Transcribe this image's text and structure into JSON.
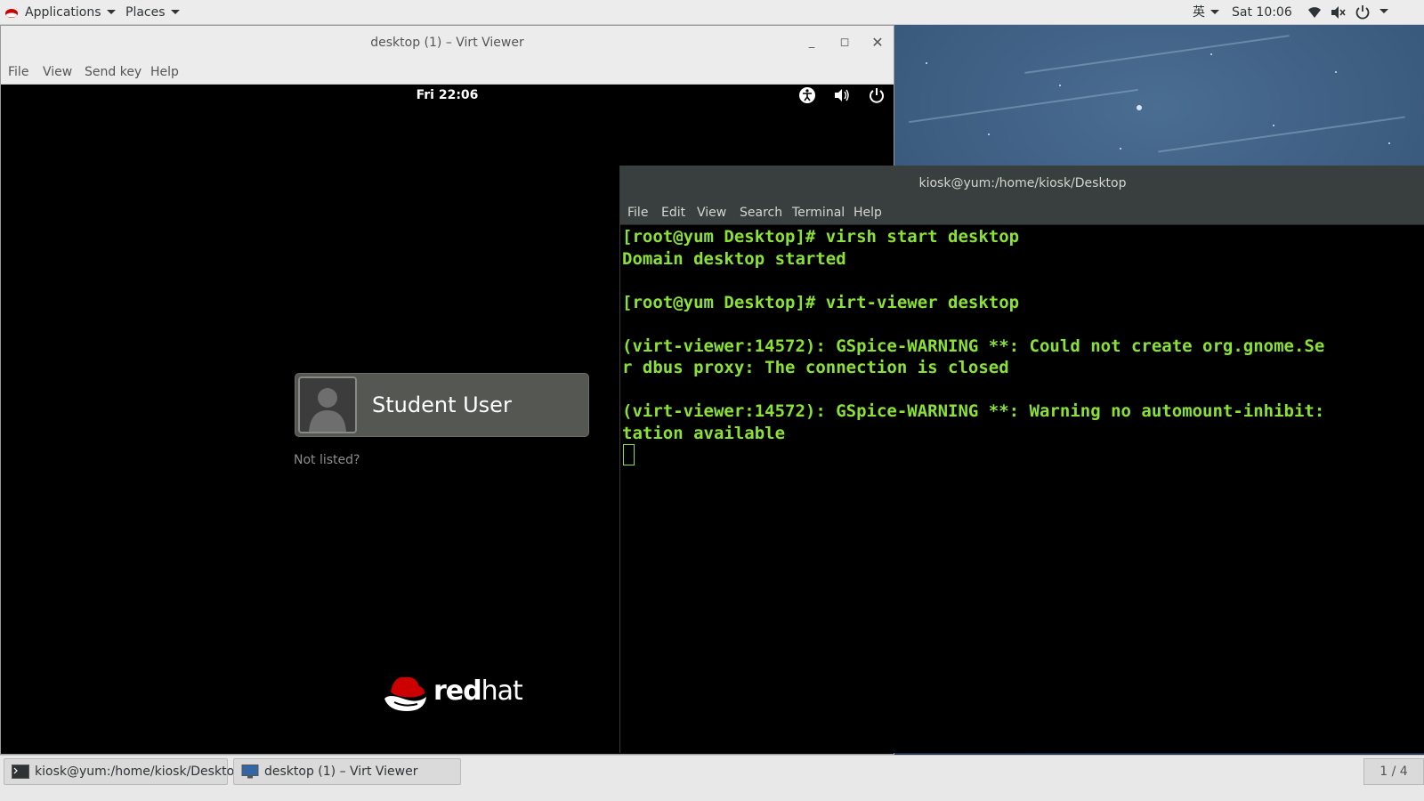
{
  "top_panel": {
    "applications_label": "Applications",
    "places_label": "Places",
    "input_method": "英",
    "clock": "Sat 10:06"
  },
  "virt_viewer": {
    "title": "desktop (1) – Virt Viewer",
    "menu": [
      "File",
      "View",
      "Send key",
      "Help"
    ],
    "vm": {
      "clock": "Fri 22:06",
      "user_name": "Student User",
      "not_listed": "Not listed?",
      "logo_text_bold": "red",
      "logo_text_light": "hat"
    }
  },
  "terminal": {
    "title": "kiosk@yum:/home/kiosk/Desktop",
    "menu": [
      "File",
      "Edit",
      "View",
      "Search",
      "Terminal",
      "Help"
    ],
    "lines": [
      "[root@yum Desktop]# virsh start desktop",
      "Domain desktop started",
      "",
      "[root@yum Desktop]# virt-viewer desktop",
      "",
      "(virt-viewer:14572): GSpice-WARNING **: Could not create org.gnome.Se",
      "r dbus proxy: The connection is closed",
      "",
      "(virt-viewer:14572): GSpice-WARNING **: Warning no automount-inhibit:",
      "tation available"
    ],
    "text_color": "#8ae234"
  },
  "bottom_panel": {
    "tasks": [
      "kiosk@yum:/home/kiosk/Desktop",
      "desktop (1) – Virt Viewer"
    ],
    "workspace": "1 / 4"
  }
}
